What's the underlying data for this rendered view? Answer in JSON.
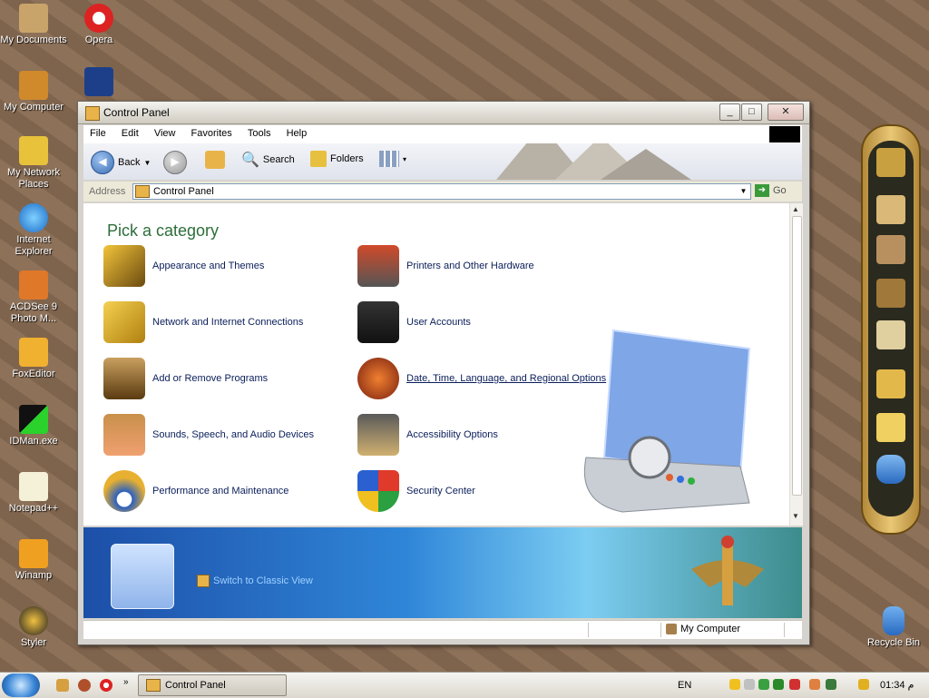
{
  "desktop": {
    "icons": [
      {
        "label": "My Documents"
      },
      {
        "label": "Opera"
      },
      {
        "label": "My Computer"
      },
      {
        "label": "My Network Places"
      },
      {
        "label": "Internet Explorer"
      },
      {
        "label": "ACDSee 9 Photo M..."
      },
      {
        "label": "FoxEditor"
      },
      {
        "label": "IDMan.exe"
      },
      {
        "label": "Notepad++"
      },
      {
        "label": "Winamp"
      },
      {
        "label": "Styler"
      },
      {
        "label": "Recycle Bin"
      }
    ]
  },
  "window": {
    "title": "Control Panel",
    "menu": [
      "File",
      "Edit",
      "View",
      "Favorites",
      "Tools",
      "Help"
    ],
    "toolbar": {
      "back": "Back",
      "search": "Search",
      "folders": "Folders"
    },
    "address": {
      "label": "Address",
      "value": "Control Panel",
      "go": "Go"
    },
    "heading": "Pick a category",
    "categories": [
      {
        "label": "Appearance and Themes"
      },
      {
        "label": "Printers and Other Hardware"
      },
      {
        "label": "Network and Internet Connections"
      },
      {
        "label": "User Accounts"
      },
      {
        "label": "Add or Remove Programs"
      },
      {
        "label": "Date, Time, Language, and Regional Options"
      },
      {
        "label": "Sounds, Speech, and Audio Devices"
      },
      {
        "label": "Accessibility Options"
      },
      {
        "label": "Performance and Maintenance"
      },
      {
        "label": "Security Center"
      }
    ],
    "switch_view": "Switch to Classic View",
    "status": "My Computer"
  },
  "taskbar": {
    "task": "Control Panel",
    "lang": "EN",
    "clock": "01:34 م"
  },
  "colors": {
    "heading": "#2d6e3a",
    "link": "#0a1e5a",
    "accent": "#3b6fb6"
  }
}
